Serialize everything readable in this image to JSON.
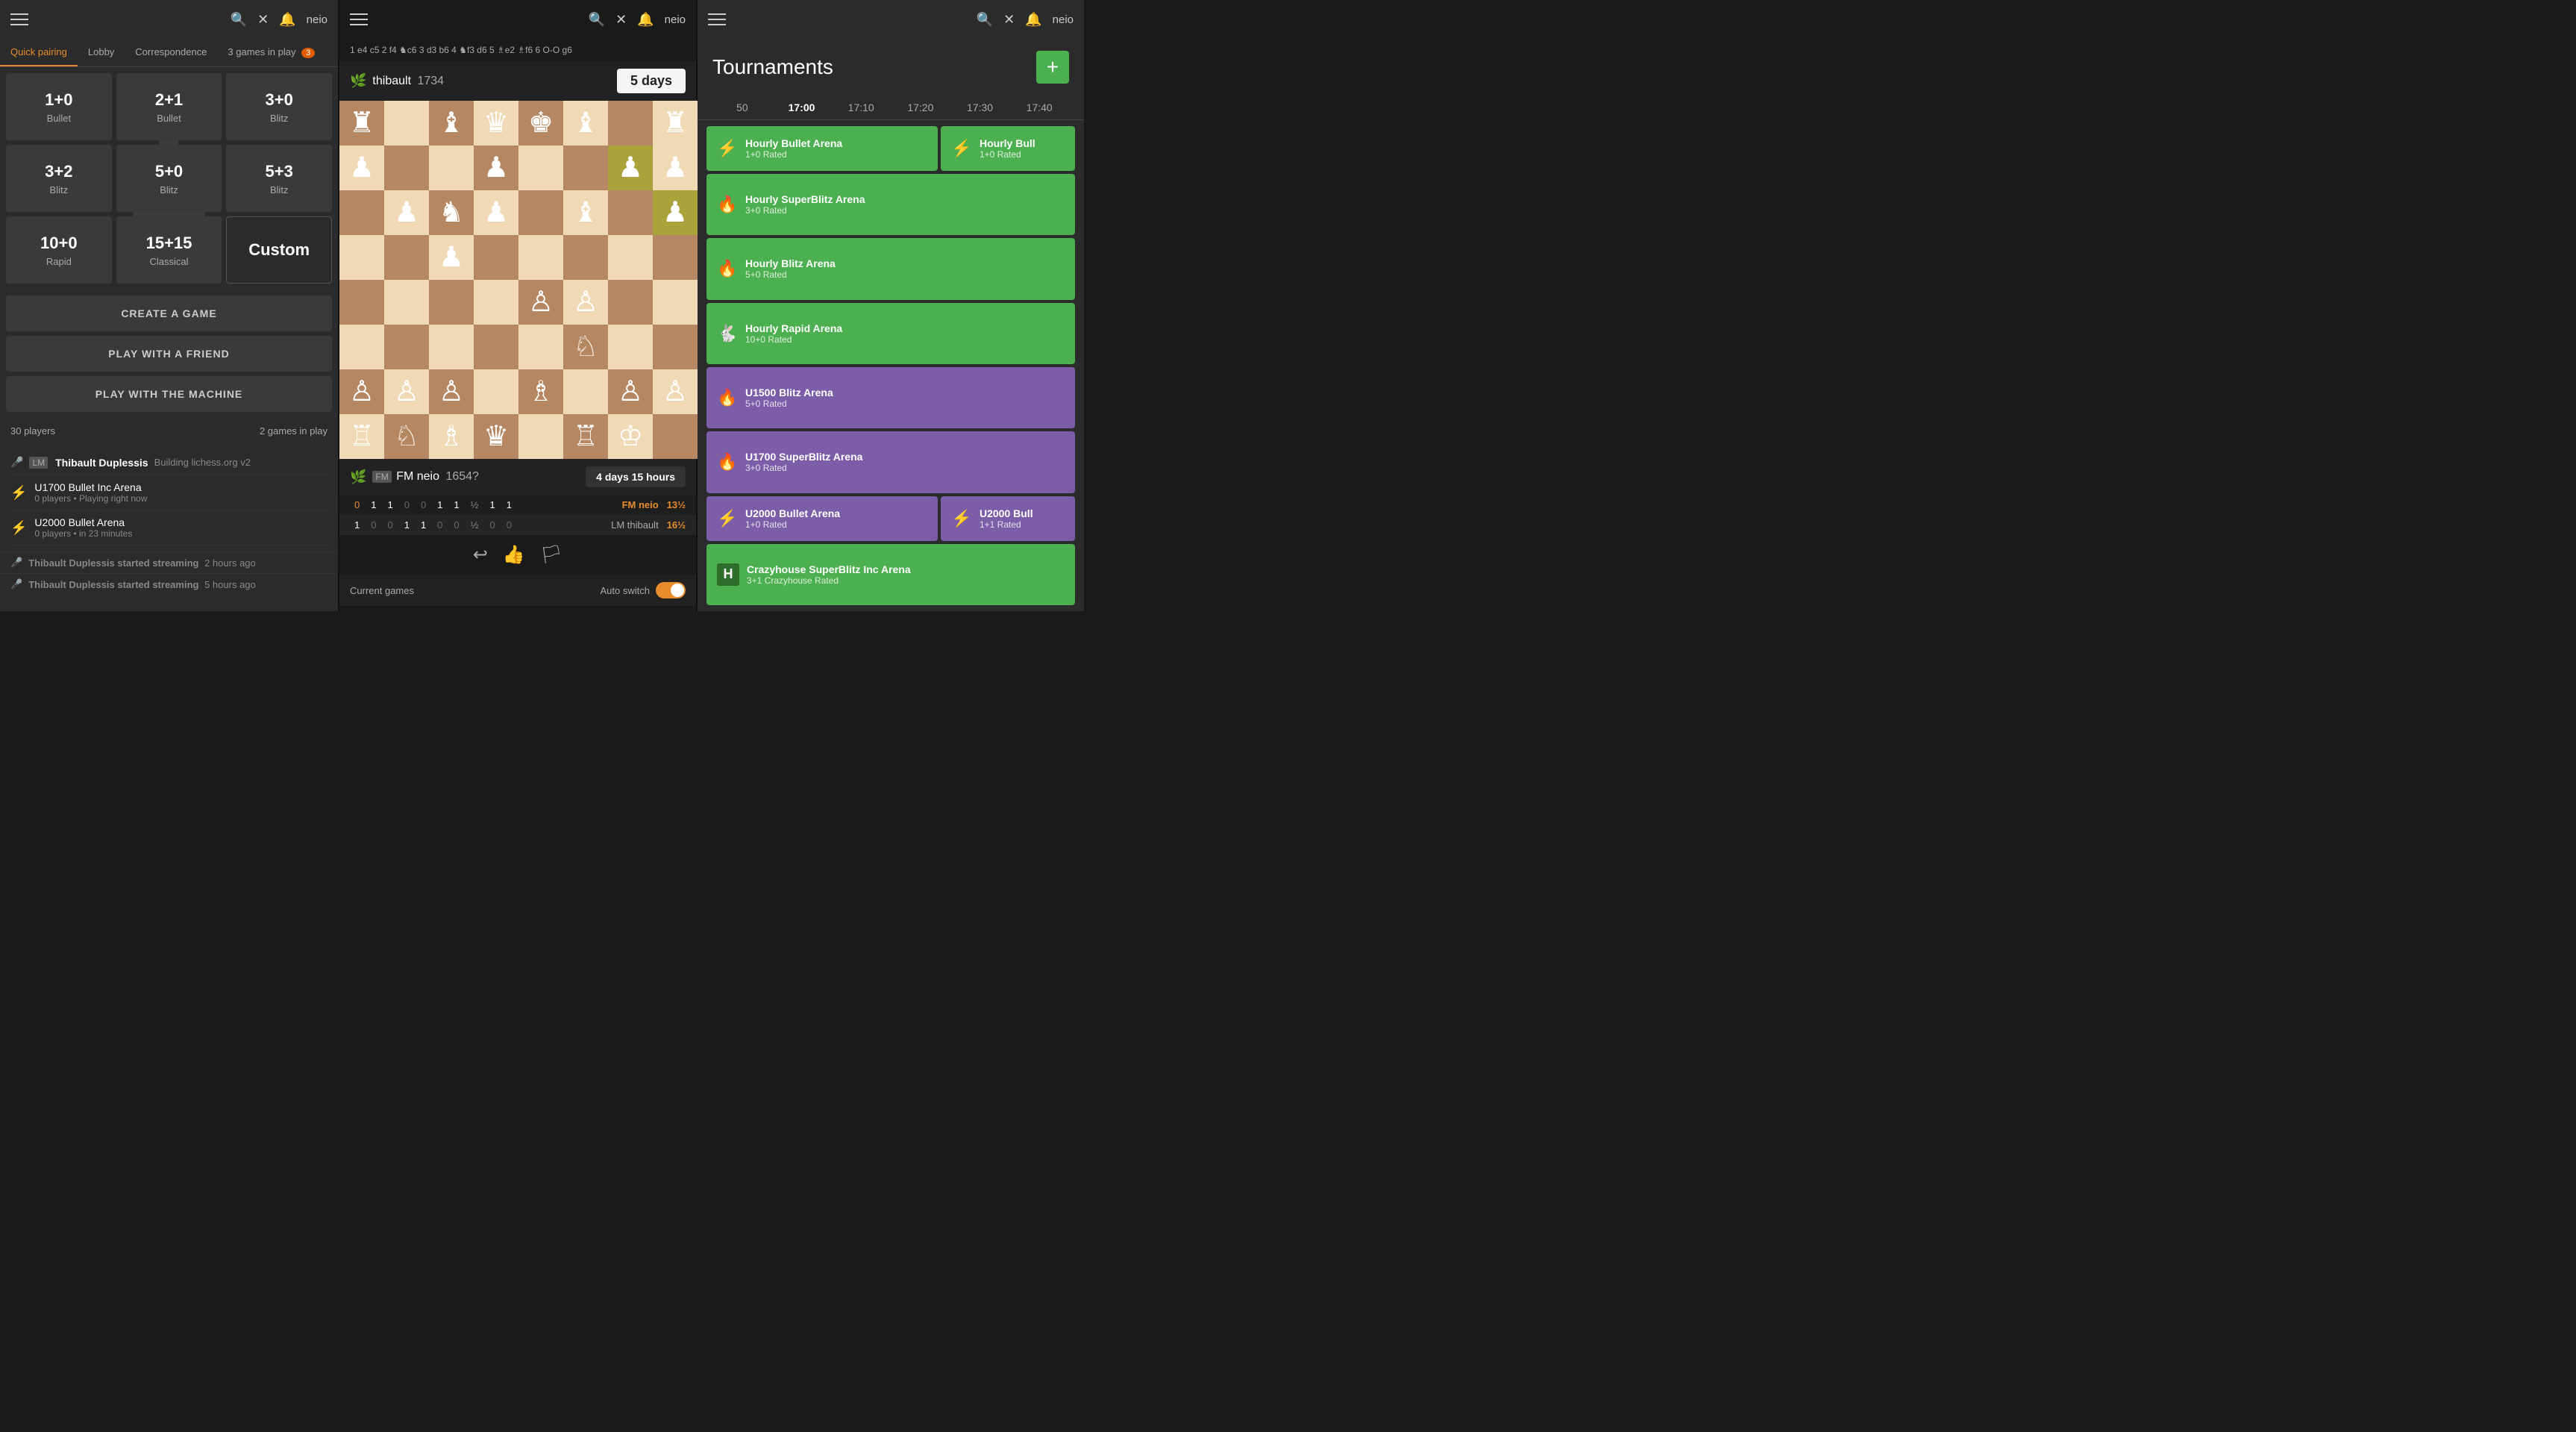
{
  "panels": {
    "left": {
      "header": {
        "username": "neio",
        "icons": [
          "menu",
          "search",
          "close",
          "bell"
        ]
      },
      "tabs": [
        {
          "label": "Quick pairing",
          "active": true
        },
        {
          "label": "Lobby",
          "active": false
        },
        {
          "label": "Correspondence",
          "active": false
        },
        {
          "label": "3 games in play",
          "badge": "3",
          "active": false
        }
      ],
      "pairings": [
        {
          "time": "1+0",
          "type": "Bullet"
        },
        {
          "time": "2+1",
          "type": "Bullet"
        },
        {
          "time": "3+0",
          "type": "Blitz"
        },
        {
          "time": "3+2",
          "type": "Blitz"
        },
        {
          "time": "5+0",
          "type": "Blitz"
        },
        {
          "time": "5+3",
          "type": "Blitz"
        },
        {
          "time": "10+0",
          "type": "Rapid"
        },
        {
          "time": "15+15",
          "type": "Classical"
        },
        {
          "time": "Custom",
          "type": "",
          "custom": true
        }
      ],
      "action_buttons": [
        {
          "label": "CREATE A GAME"
        },
        {
          "label": "PLAY WITH A FRIEND"
        },
        {
          "label": "PLAY WITH THE MACHINE"
        }
      ],
      "stats": {
        "players": "30 players",
        "games": "2 games in play"
      },
      "lobby_user": {
        "rank": "LM",
        "name": "Thibault Duplessis",
        "desc": "Building lichess.org v2"
      },
      "events": [
        {
          "title": "U1700 Bullet Inc Arena",
          "sub": "0 players • Playing right now"
        },
        {
          "title": "U2000 Bullet Arena",
          "sub": "0 players • in 23 minutes"
        }
      ],
      "streams": [
        {
          "text": "Thibault Duplessis started streaming",
          "time": "2 hours ago"
        },
        {
          "text": "Thibault Duplessis started streaming",
          "time": "5 hours ago"
        }
      ]
    },
    "middle": {
      "header": {
        "username": "neio"
      },
      "move_notation": "1 e4 c5 2 f4 ♞c6 3 d3 b6 4 ♞f3 d6 5 ♗e2 ♗f6 6 O-O g6",
      "top_player": {
        "flag": "🌿",
        "name": "thibault",
        "rating": "1734",
        "time": "5 days"
      },
      "bottom_player": {
        "flag": "🌿",
        "name": "FM neio",
        "rating": "1654?",
        "time": "4 days 15 hours"
      },
      "score_row_top": {
        "values": [
          "0",
          "1",
          "1",
          "0",
          "0",
          "1",
          "1",
          "½",
          "1",
          "1"
        ],
        "player": "FM neio",
        "pct": "13½"
      },
      "score_row_bottom": {
        "values": [
          "1",
          "0",
          "0",
          "1",
          "1",
          "0",
          "0",
          "½",
          "0",
          "0"
        ],
        "player": "LM thibault",
        "pct": "16½"
      },
      "controls": [
        "undo",
        "thumbsup",
        "flag"
      ],
      "footer": {
        "current_games": "Current games",
        "auto_switch": "Auto switch"
      }
    },
    "right": {
      "header": {
        "username": "neio",
        "title": "Tournaments"
      },
      "add_button": "+",
      "timeline": [
        "50",
        "17:00",
        "17:10",
        "17:20",
        "17:30",
        "17:40"
      ],
      "tournaments": [
        {
          "type": "green",
          "icon": "⚡",
          "title": "Hourly Bullet Arena",
          "sub": "1+0 Rated"
        },
        {
          "type": "green",
          "icon": "⚡",
          "title": "Hourly Bull",
          "sub": "1+0 Rated",
          "partial": true
        },
        {
          "type": "green",
          "icon": "🔥",
          "title": "Hourly SuperBlitz Arena",
          "sub": "3+0 Rated"
        },
        {
          "type": "green",
          "icon": "🔥",
          "title": "Hourly Blitz Arena",
          "sub": "5+0 Rated"
        },
        {
          "type": "green",
          "icon": "🐇",
          "title": "Hourly Rapid Arena",
          "sub": "10+0 Rated"
        },
        {
          "type": "purple",
          "icon": "🔥",
          "title": "U1500 Blitz Arena",
          "sub": "5+0 Rated"
        },
        {
          "type": "purple",
          "icon": "🔥",
          "title": "U1700 SuperBlitz Arena",
          "sub": "3+0 Rated"
        },
        {
          "type": "purple",
          "icon": "⚡",
          "title": "U2000 Bullet Arena",
          "sub": "1+0 Rated"
        },
        {
          "type": "purple",
          "icon": "⚡",
          "title": "U2000 Bull",
          "sub": "1+1 Rated",
          "partial": true
        },
        {
          "type": "green",
          "icon": "H",
          "title": "Crazyhouse SuperBlitz Inc Arena",
          "sub": "3+1 Crazyhouse Rated",
          "special": true
        }
      ]
    }
  }
}
